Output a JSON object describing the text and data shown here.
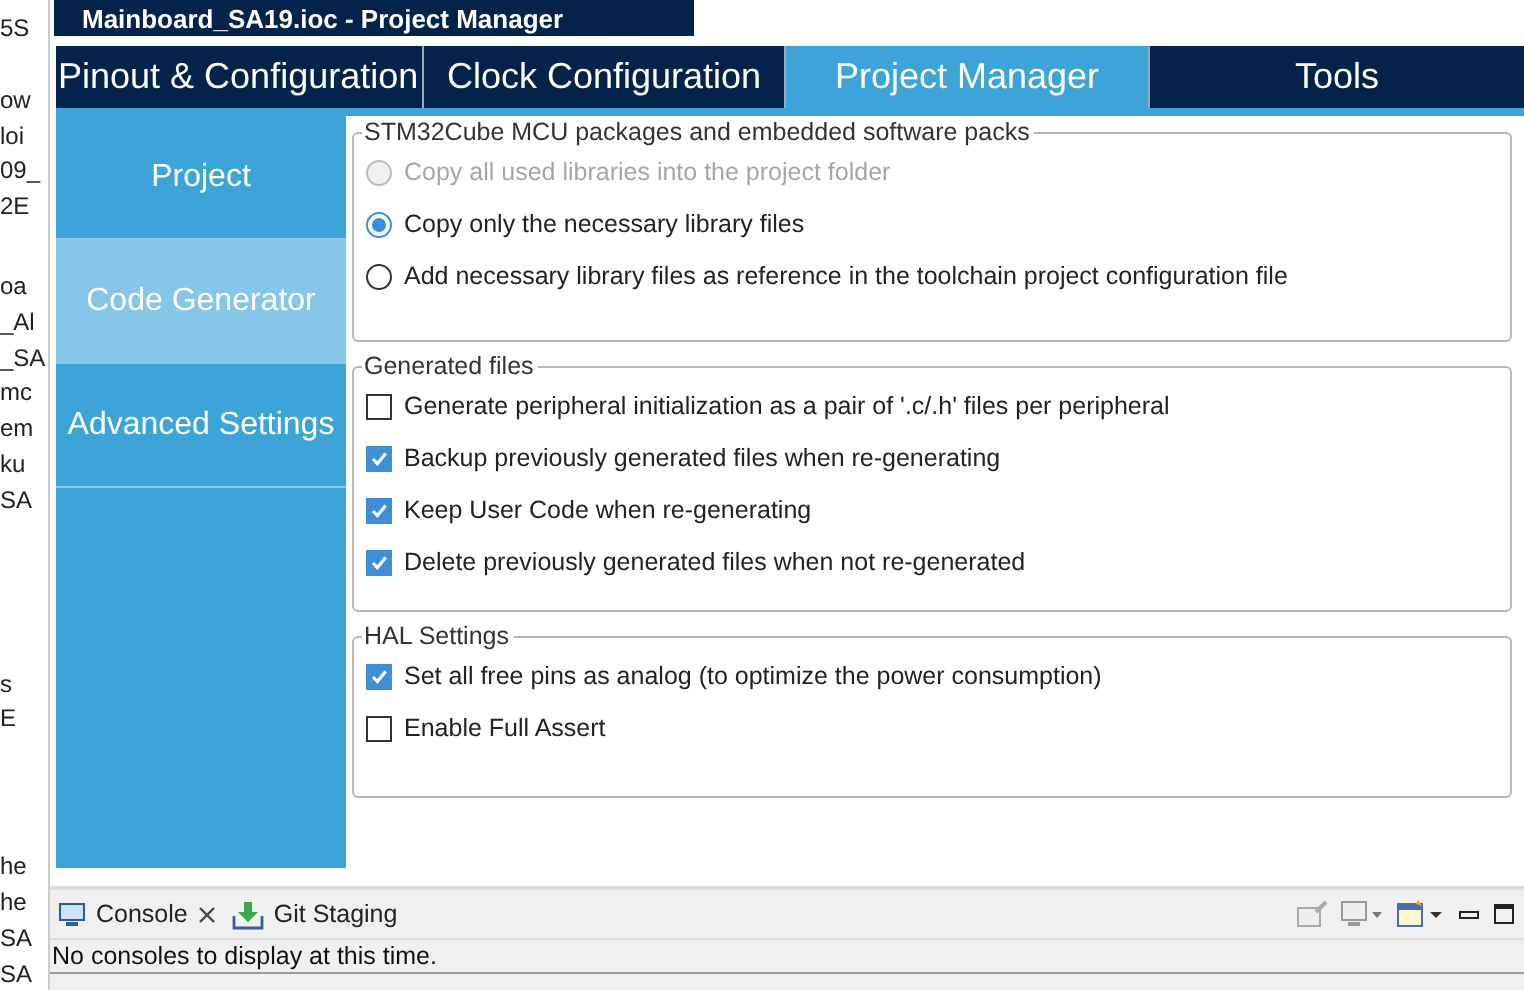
{
  "side_fragments": [
    [
      "5S"
    ],
    [
      "ow",
      "loi",
      "09_",
      "2E"
    ],
    [
      "oa",
      "_Al",
      "_SA",
      "mc",
      "em",
      "ku",
      "SA"
    ],
    [
      "s",
      "E"
    ],
    [
      "he",
      "he",
      "SA",
      "SA"
    ]
  ],
  "window": {
    "title": "Mainboard_SA19.ioc - Project Manager"
  },
  "tabs": [
    {
      "label": "Pinout & Configuration",
      "selected": false
    },
    {
      "label": "Clock Configuration",
      "selected": false
    },
    {
      "label": "Project Manager",
      "selected": true
    },
    {
      "label": "Tools",
      "selected": false
    }
  ],
  "sidebar": {
    "items": [
      {
        "label": "Project",
        "selected": false
      },
      {
        "label": "Code Generator",
        "selected": true
      },
      {
        "label": "Advanced Settings",
        "selected": false
      }
    ]
  },
  "groups": [
    {
      "title": "STM32Cube MCU packages and embedded software packs",
      "options": [
        {
          "kind": "radio",
          "label": "Copy all used libraries into the project folder",
          "selected": false,
          "disabled": true
        },
        {
          "kind": "radio",
          "label": "Copy only the necessary library files",
          "selected": true,
          "disabled": false
        },
        {
          "kind": "radio",
          "label": "Add necessary library files as reference in the toolchain project configuration file",
          "selected": false,
          "disabled": false
        }
      ]
    },
    {
      "title": "Generated files",
      "options": [
        {
          "kind": "checkbox",
          "label": "Generate peripheral initialization as a pair of '.c/.h' files per peripheral",
          "checked": false
        },
        {
          "kind": "checkbox",
          "label": "Backup previously generated files when re-generating",
          "checked": true
        },
        {
          "kind": "checkbox",
          "label": "Keep User Code when re-generating",
          "checked": true
        },
        {
          "kind": "checkbox",
          "label": "Delete previously generated files when not re-generated",
          "checked": true
        }
      ]
    },
    {
      "title": "HAL Settings",
      "options": [
        {
          "kind": "checkbox",
          "label": "Set all free pins as analog (to optimize the power consumption)",
          "checked": true
        },
        {
          "kind": "checkbox",
          "label": "Enable Full Assert",
          "checked": false
        }
      ]
    }
  ],
  "bottom_panel": {
    "tabs": [
      {
        "label": "Console",
        "closable": true
      },
      {
        "label": "Git Staging",
        "closable": false
      }
    ],
    "message": "No consoles to display at this time."
  }
}
